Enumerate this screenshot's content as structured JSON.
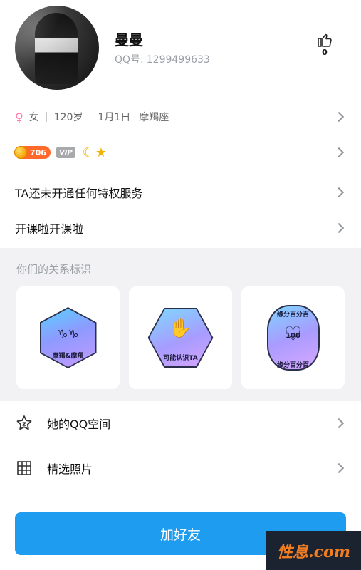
{
  "profile": {
    "name": "曼曼",
    "qq_label": "QQ号:",
    "qq_number": "1299499633",
    "like_count": "0"
  },
  "info": {
    "gender": "女",
    "age": "120岁",
    "birthday": "1月1日",
    "zodiac": "摩羯座"
  },
  "badges": {
    "level": "706",
    "vip": "VIP"
  },
  "privilege_text": "TA还未开通任何特权服务",
  "signature_text": "开课啦开课啦",
  "relations": {
    "title": "你们的关系标识",
    "cards": [
      {
        "label": "摩羯&摩羯"
      },
      {
        "label": "可能认识TA"
      },
      {
        "label_top": "缘分百分百",
        "label_bottom": "缘分百分百",
        "number": "100"
      }
    ]
  },
  "menu": {
    "qzone": "她的QQ空间",
    "photos": "精选照片"
  },
  "add_friend": "加好友",
  "watermark": "性息.com",
  "colors": {
    "primary_button": "#1e9cf0",
    "gender_icon": "#ff7aa8",
    "level_badge": "#ff6a2b"
  },
  "icons": {
    "like": "thumb-up-icon",
    "gender": "female-icon",
    "qzone": "star-outline-icon",
    "photos": "grid-icon",
    "chevron": "chevron-right-icon"
  }
}
